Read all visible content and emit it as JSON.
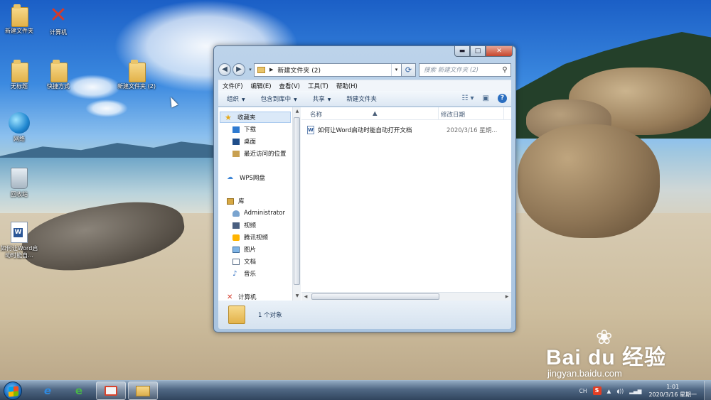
{
  "desktop": {
    "icons": [
      {
        "label": "新建文件夹",
        "icon": "folder-icon"
      },
      {
        "label": "计算机",
        "icon": "computer-icon"
      },
      {
        "label": "无标题",
        "icon": "folder-icon"
      },
      {
        "label": "快捷方式",
        "icon": "folder-icon"
      },
      {
        "label": "新建文件夹 (2)",
        "icon": "folder-icon"
      },
      {
        "label": "网络",
        "icon": "network-icon"
      },
      {
        "label": "回收站",
        "icon": "recycle-bin-icon"
      },
      {
        "label": "如何让Word启动时能自...",
        "icon": "word-document-icon"
      }
    ]
  },
  "window": {
    "address": {
      "path": "新建文件夹 (2)",
      "search_placeholder": "搜索 新建文件夹 (2)"
    },
    "title_buttons": {
      "minimize": "▬",
      "maximize": "□",
      "close": "✕"
    },
    "menu": [
      "文件(F)",
      "编辑(E)",
      "查看(V)",
      "工具(T)",
      "帮助(H)"
    ],
    "toolbar": {
      "organize": "组织",
      "include_in_library": "包含到库中",
      "share": "共享",
      "new_folder": "新建文件夹"
    },
    "nav": {
      "favorites": "收藏夹",
      "downloads": "下载",
      "desktop": "桌面",
      "recent": "最近访问的位置",
      "wps": "WPS网盘",
      "libraries": "库",
      "administrator": "Administrator",
      "videos": "视频",
      "tencent_video": "腾讯视频",
      "pictures": "图片",
      "documents": "文档",
      "music": "音乐",
      "computer": "计算机"
    },
    "columns": {
      "name": "名称",
      "date": "修改日期"
    },
    "files": [
      {
        "name": "如何让Word启动时能自动打开文档",
        "date": "2020/3/16 星期..."
      }
    ],
    "status": "1 个对象"
  },
  "taskbar": {
    "lang": "CH",
    "ime": "S",
    "time": "1:01",
    "date": "2020/3/16 星期一"
  },
  "watermark": {
    "brand": "Bai du 经验",
    "url": "jingyan.baidu.com"
  },
  "colors": {
    "window_frame": "#a9c4e0",
    "close_button": "#c6452c",
    "folder_yellow": "#e2b24a"
  }
}
